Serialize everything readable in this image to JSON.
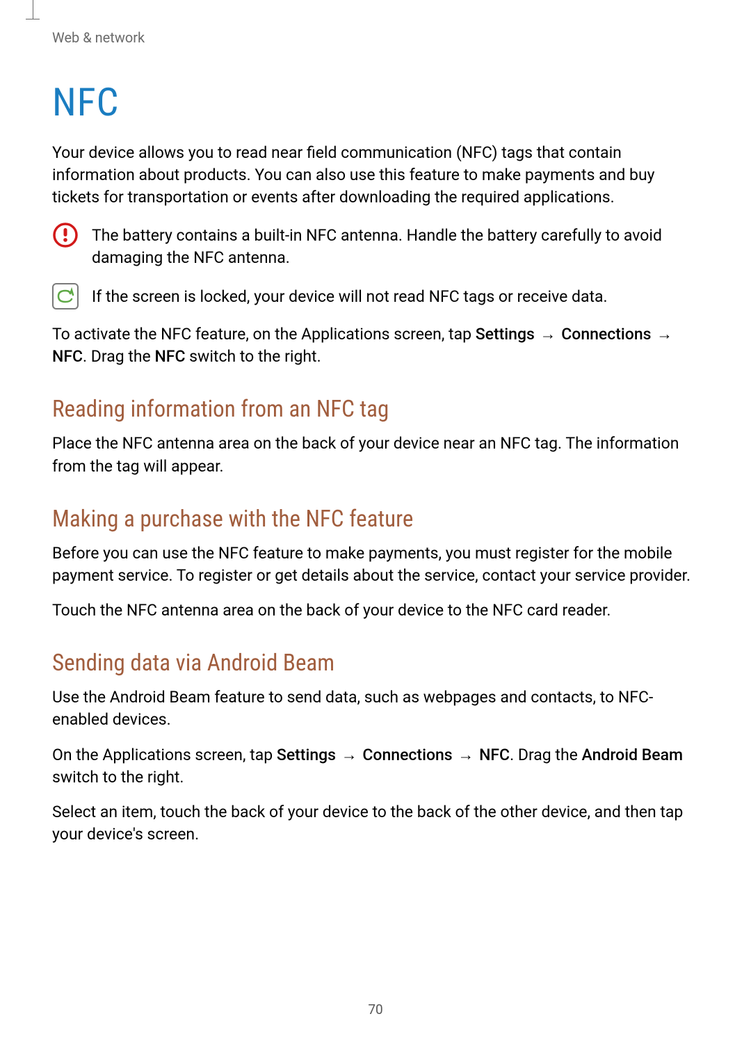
{
  "header": {
    "section": "Web & network"
  },
  "title": "NFC",
  "intro": "Your device allows you to read near field communication (NFC) tags that contain information about products. You can also use this feature to make payments and buy tickets for transportation or events after downloading the required applications.",
  "caution_note": "The battery contains a built-in NFC antenna. Handle the battery carefully to avoid damaging the NFC antenna.",
  "tip_note": "If the screen is locked, your device will not read NFC tags or receive data.",
  "activation": {
    "prefix": "To activate the NFC feature, on the Applications screen, tap ",
    "path_settings": "Settings",
    "arrow1": " → ",
    "path_connections": "Connections",
    "arrow2": " → ",
    "path_nfc": "NFC",
    "suffix1": ". Drag the ",
    "nfc_switch": "NFC",
    "suffix2": " switch to the right."
  },
  "section_reading": {
    "title": "Reading information from an NFC tag",
    "body": "Place the NFC antenna area on the back of your device near an NFC tag. The information from the tag will appear."
  },
  "section_purchase": {
    "title": "Making a purchase with the NFC feature",
    "body1": "Before you can use the NFC feature to make payments, you must register for the mobile payment service. To register or get details about the service, contact your service provider.",
    "body2": "Touch the NFC antenna area on the back of your device to the NFC card reader."
  },
  "section_beam": {
    "title": "Sending data via Android Beam",
    "body1": "Use the Android Beam feature to send data, such as webpages and contacts, to NFC-enabled devices.",
    "body2_prefix": "On the Applications screen, tap ",
    "body2_settings": "Settings",
    "body2_arrow1": " → ",
    "body2_connections": "Connections",
    "body2_arrow2": " → ",
    "body2_nfc": "NFC",
    "body2_mid": ". Drag the ",
    "body2_beam": "Android Beam",
    "body2_suffix": " switch to the right.",
    "body3": "Select an item, touch the back of your device to the back of the other device, and then tap your device's screen."
  },
  "page_number": "70"
}
